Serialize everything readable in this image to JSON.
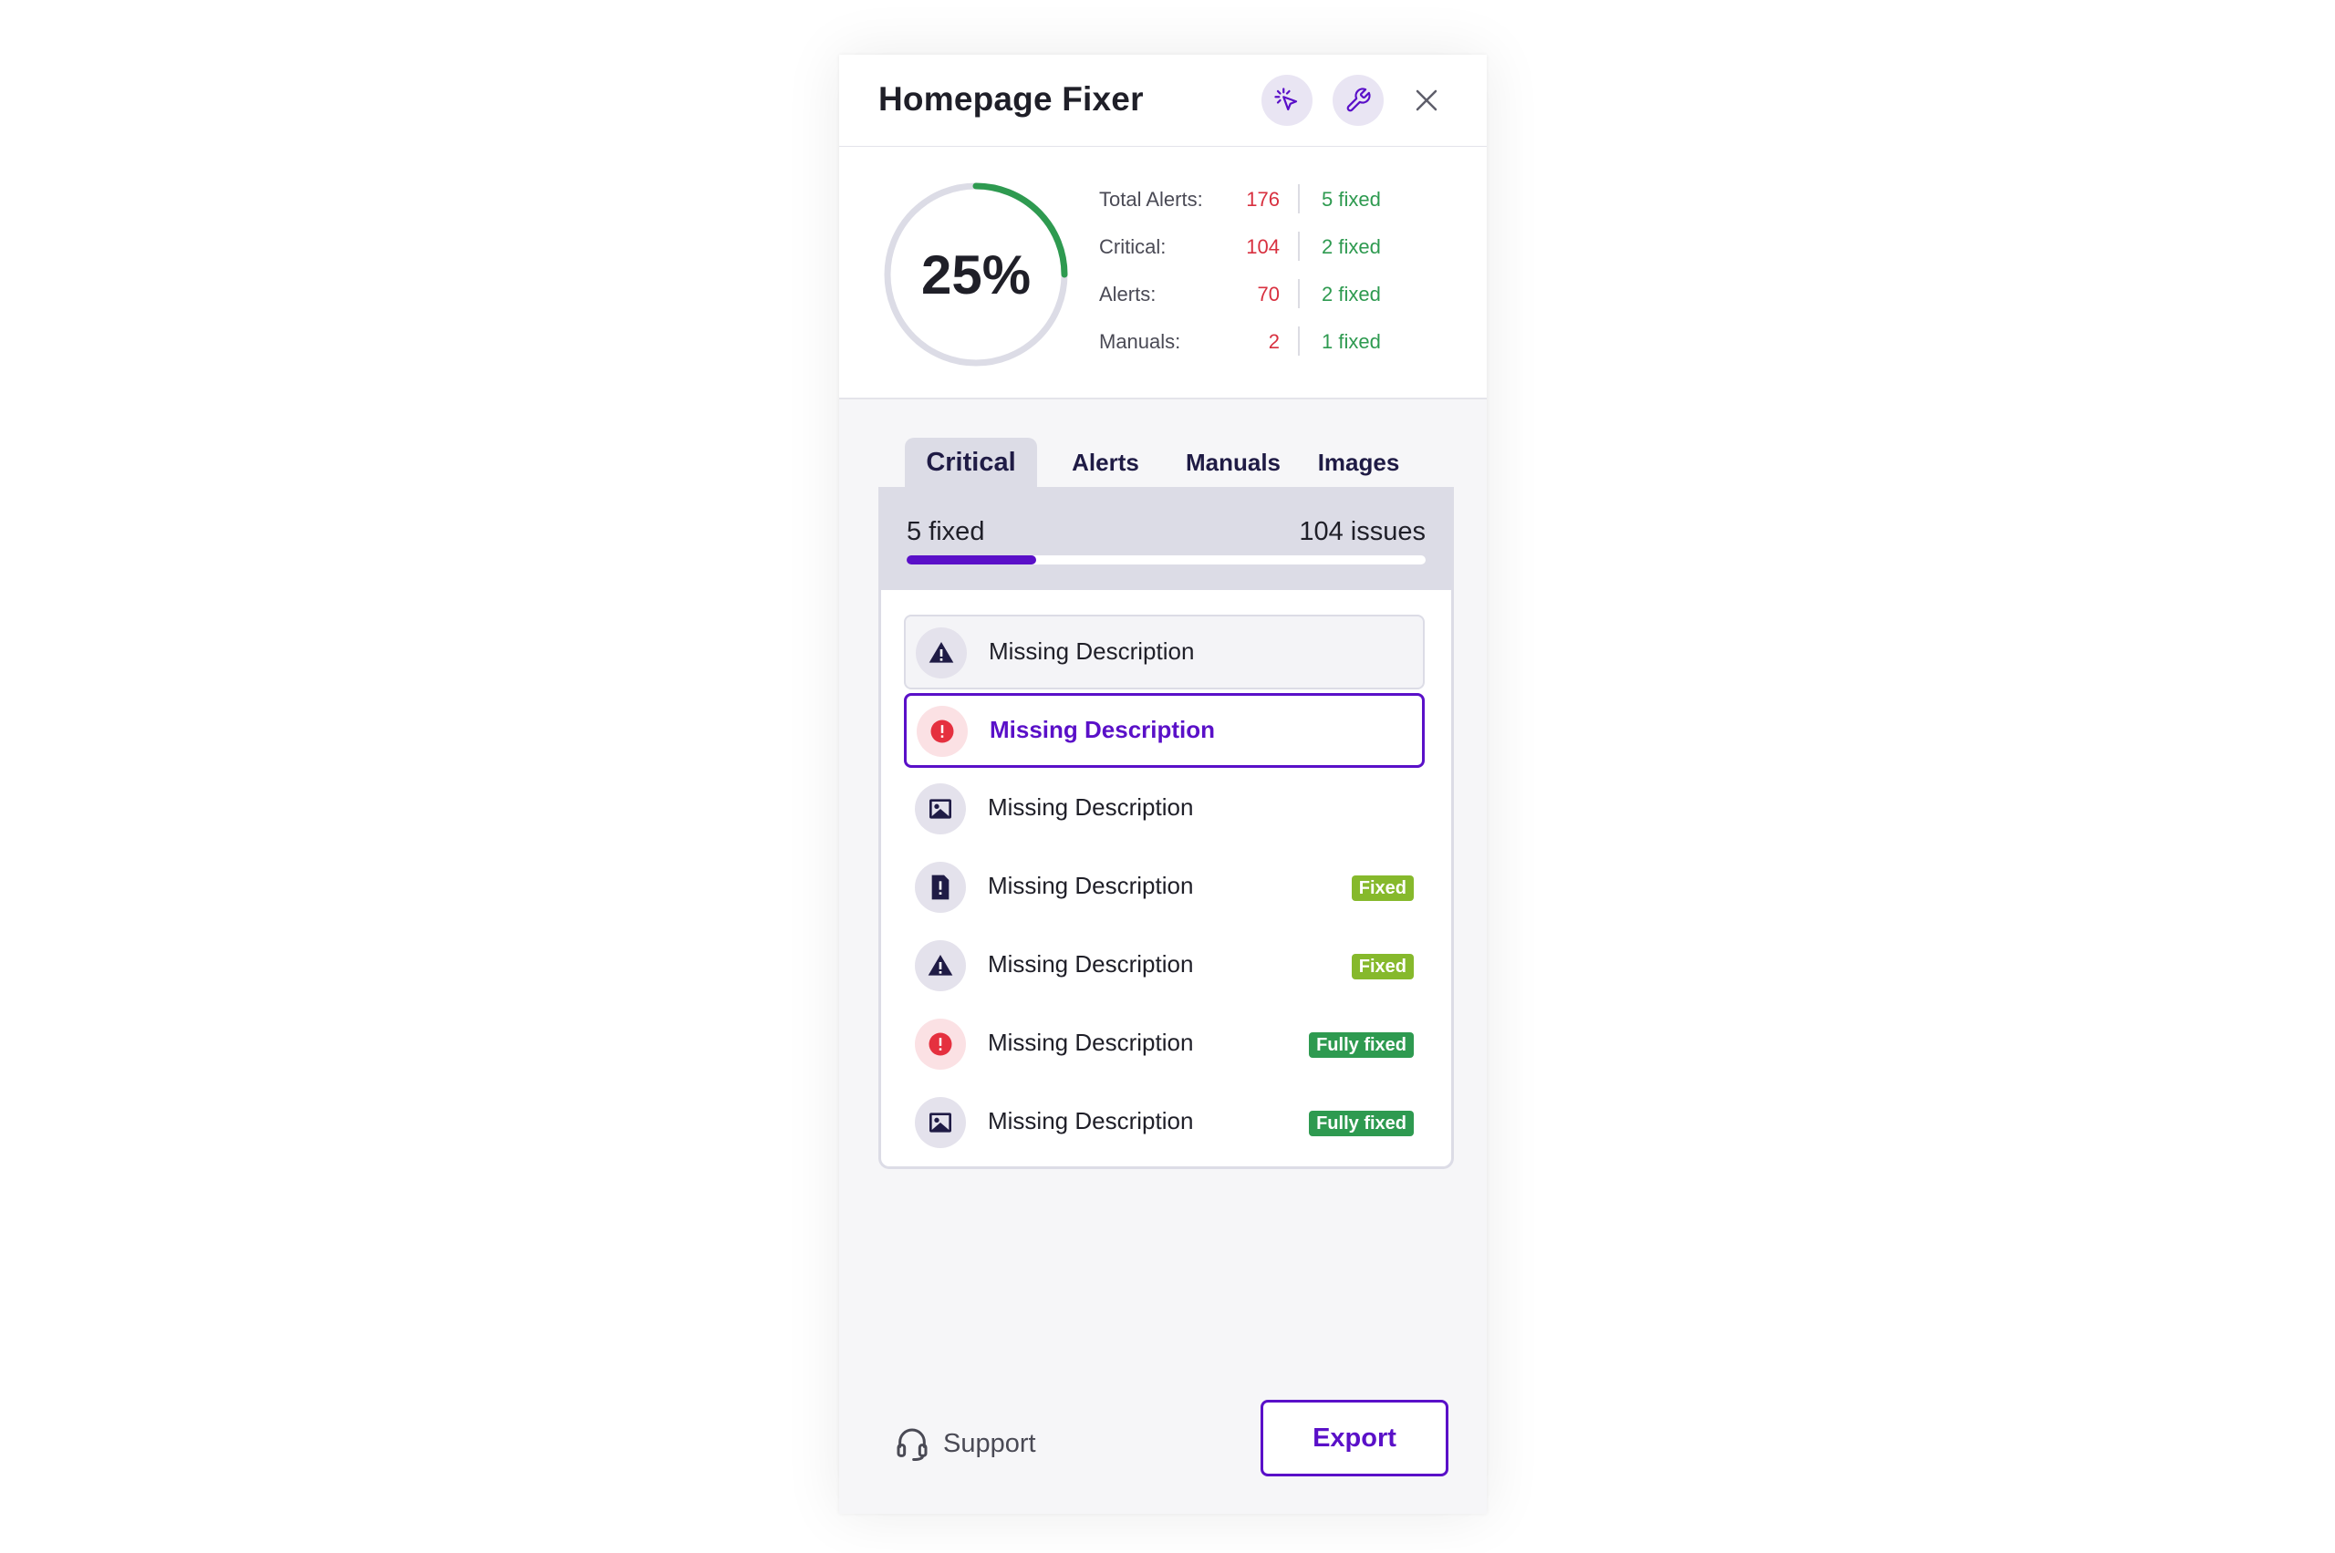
{
  "header": {
    "title": "Homepage Fixer",
    "magic_icon": "cursor-sparkle-icon",
    "tools_icon": "wrench-icon",
    "close_icon": "close-icon"
  },
  "summary": {
    "percent_label": "25%",
    "percent_value": 0.25,
    "ring_colors": {
      "track": "#dcdce6",
      "progress": "#2e9a50"
    },
    "stats": [
      {
        "label": "Total Alerts:",
        "count": "176",
        "fixed": "5 fixed"
      },
      {
        "label": "Critical:",
        "count": "104",
        "fixed": "2 fixed"
      },
      {
        "label": "Alerts:",
        "count": "70",
        "fixed": "2 fixed"
      },
      {
        "label": "Manuals:",
        "count": "2",
        "fixed": "1 fixed"
      }
    ]
  },
  "tabs": [
    {
      "label": "Critical",
      "active": true
    },
    {
      "label": "Alerts",
      "active": false
    },
    {
      "label": "Manuals",
      "active": false
    },
    {
      "label": "Images",
      "active": false
    }
  ],
  "card": {
    "fixed_label": "5 fixed",
    "issues_label": "104 issues",
    "progress_fraction": 0.25
  },
  "issues": [
    {
      "label": "Missing Description",
      "icon": "warning-triangle-icon",
      "state": "hover",
      "badge": ""
    },
    {
      "label": "Missing Description",
      "icon": "error-circle-icon",
      "state": "selected",
      "badge": ""
    },
    {
      "label": "Missing Description",
      "icon": "image-icon",
      "state": "normal",
      "badge": ""
    },
    {
      "label": "Missing Description",
      "icon": "document-alert-icon",
      "state": "normal",
      "badge": "Fixed"
    },
    {
      "label": "Missing Description",
      "icon": "warning-triangle-icon",
      "state": "normal",
      "badge": "Fixed"
    },
    {
      "label": "Missing Description",
      "icon": "error-circle-icon",
      "state": "normal",
      "badge": "Fully fixed"
    },
    {
      "label": "Missing Description",
      "icon": "image-icon",
      "state": "normal",
      "badge": "Fully fixed"
    }
  ],
  "footer": {
    "support_label": "Support",
    "support_icon": "headset-icon",
    "export_label": "Export"
  },
  "colors": {
    "accent": "#5a10c8",
    "danger": "#d8303f",
    "success": "#2e9a50",
    "badge_fixed": "#86b92c"
  }
}
